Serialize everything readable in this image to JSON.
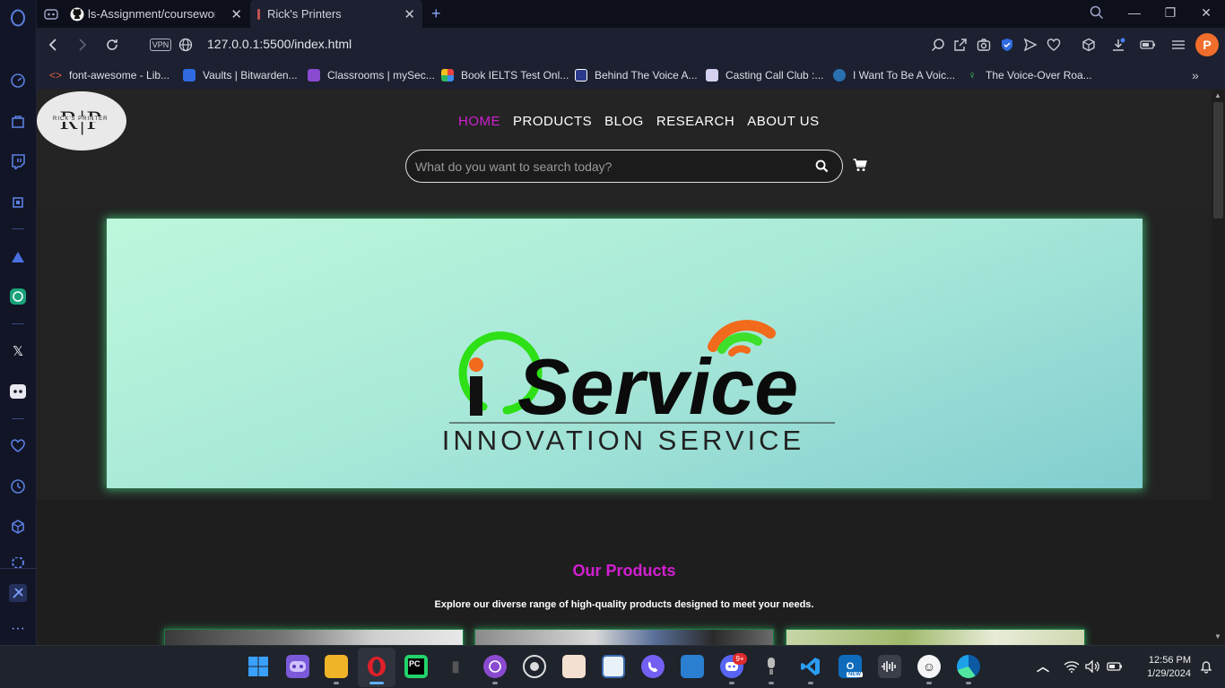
{
  "browser": {
    "tabs": [
      {
        "label": "ls-Assignment/coursework/",
        "icon": "github-icon"
      },
      {
        "label": "Rick's Printers",
        "icon": "page-icon"
      }
    ],
    "url": "127.0.0.1:5500/index.html",
    "vpn_label": "VPN",
    "profile_initial": "P",
    "bookmarks": [
      "font-awesome - Lib...",
      "Vaults | Bitwarden...",
      "Classrooms | mySec...",
      "Book IELTS Test Onl...",
      "Behind The Voice A...",
      "Casting Call Club :...",
      "I Want To Be A Voic...",
      "The Voice-Over Roa..."
    ]
  },
  "site": {
    "logo_letters": "R|P",
    "logo_subtitle": "RICK'S PRINTER",
    "nav": [
      "HOME",
      "PRODUCTS",
      "BLOG",
      "RESEARCH",
      "ABOUT US"
    ],
    "active_nav": "HOME",
    "search_placeholder": "What do you want to search today?",
    "hero": {
      "brand_letter": "i",
      "brand_word": "Service",
      "tagline": "INNOVATION SERVICE"
    },
    "products_title": "Our Products",
    "products_subtitle": "Explore our diverse range of high-quality products designed to meet your needs."
  },
  "taskbar": {
    "time": "12:56 PM",
    "date": "1/29/2024",
    "discord_badge": "9+",
    "outlook_badge": "NEW"
  },
  "colors": {
    "accent_magenta": "#d21fd2",
    "hero_glow": "#50ff96",
    "opera_red": "#e0202a",
    "profile_orange": "#f06d2b"
  }
}
